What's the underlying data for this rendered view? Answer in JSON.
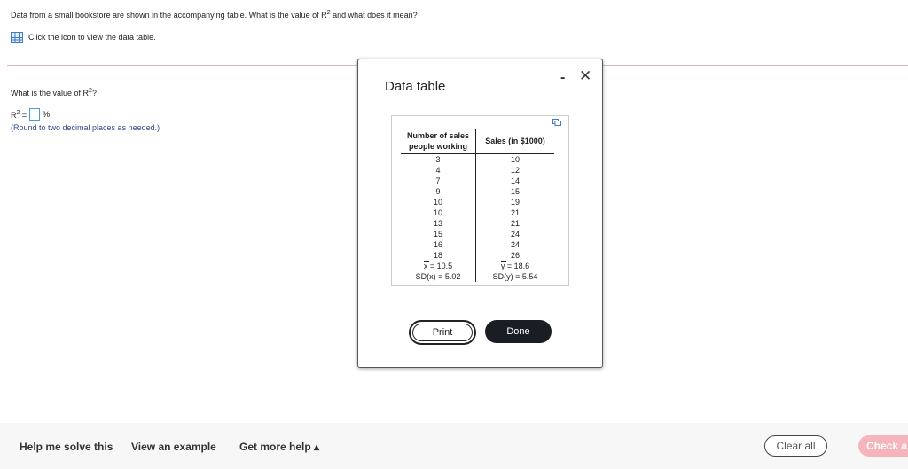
{
  "question": {
    "text_before_sup": "Data from a small bookstore are shown in the accompanying table. What is the value of R",
    "sup": "2",
    "text_after_sup": " and what does it mean?"
  },
  "data_link": {
    "label": "Click the icon to view the data table."
  },
  "prompt": {
    "text": "What is the value of R",
    "sup": "2",
    "tail": "?"
  },
  "answer": {
    "label": "R",
    "sup": "2",
    "equals": " = ",
    "unit": "%"
  },
  "hint": "(Round to two decimal places as needed.)",
  "modal": {
    "title": "Data table",
    "minimize": "-",
    "close": "✕",
    "print_label": "Print",
    "done_label": "Done"
  },
  "table": {
    "headers": [
      "Number of sales people working",
      "Sales (in $1000)"
    ],
    "rows": [
      [
        "3",
        "10"
      ],
      [
        "4",
        "12"
      ],
      [
        "7",
        "14"
      ],
      [
        "9",
        "15"
      ],
      [
        "10",
        "19"
      ],
      [
        "10",
        "21"
      ],
      [
        "13",
        "21"
      ],
      [
        "15",
        "24"
      ],
      [
        "16",
        "24"
      ],
      [
        "18",
        "26"
      ]
    ],
    "summary": [
      [
        "x = 10.5",
        "y = 18.6"
      ],
      [
        "SD(x) = 5.02",
        "SD(y) = 5.54"
      ]
    ]
  },
  "footer": {
    "help": "Help me solve this",
    "example": "View an example",
    "more": "Get more help ▴",
    "clear": "Clear all",
    "check": "Check a"
  }
}
